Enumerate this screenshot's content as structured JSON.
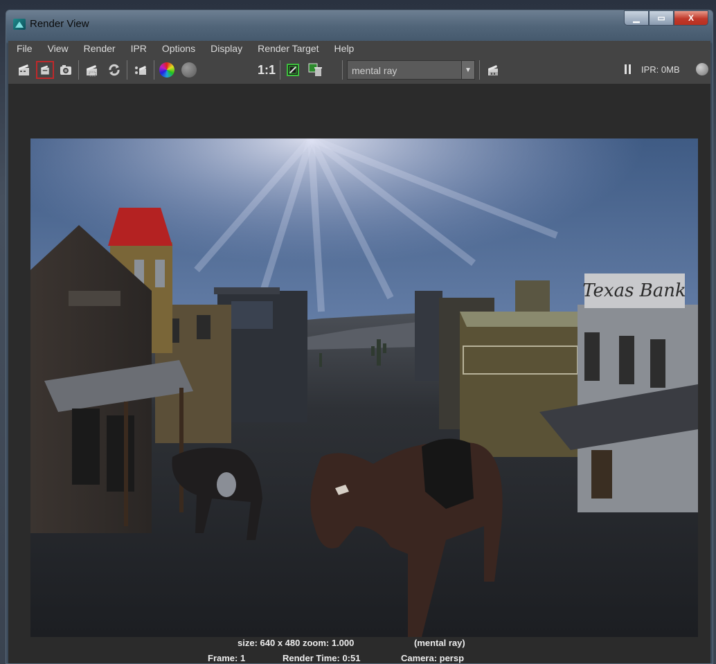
{
  "window": {
    "title": "Render View",
    "controls": {
      "minimize": "–",
      "maximize": "□",
      "close": "X"
    }
  },
  "menu": [
    "File",
    "View",
    "Render",
    "IPR",
    "Options",
    "Display",
    "Render Target",
    "Help"
  ],
  "toolbar": {
    "ratio_label": "1:1",
    "renderer_select": {
      "value": "mental ray"
    },
    "ipr_label": "IPR: 0MB"
  },
  "scene": {
    "bank_sign": "Texas Bank"
  },
  "status": {
    "size_zoom": "size: 640 x 480 zoom: 1.000",
    "renderer": "(mental ray)",
    "frame": "Frame: 1",
    "render_time": "Render Time: 0:51",
    "camera": "Camera: persp"
  },
  "icons": [
    "render-frame-icon",
    "redo-render-icon",
    "snapshot-icon",
    "render-region-icon",
    "refresh-icon",
    "ipr-render-icon",
    "rgb-channels-icon",
    "alpha-channel-icon",
    "display-real-size-icon",
    "keep-image-icon",
    "remove-image-icon",
    "render-settings-icon",
    "pause-ipr-icon"
  ]
}
